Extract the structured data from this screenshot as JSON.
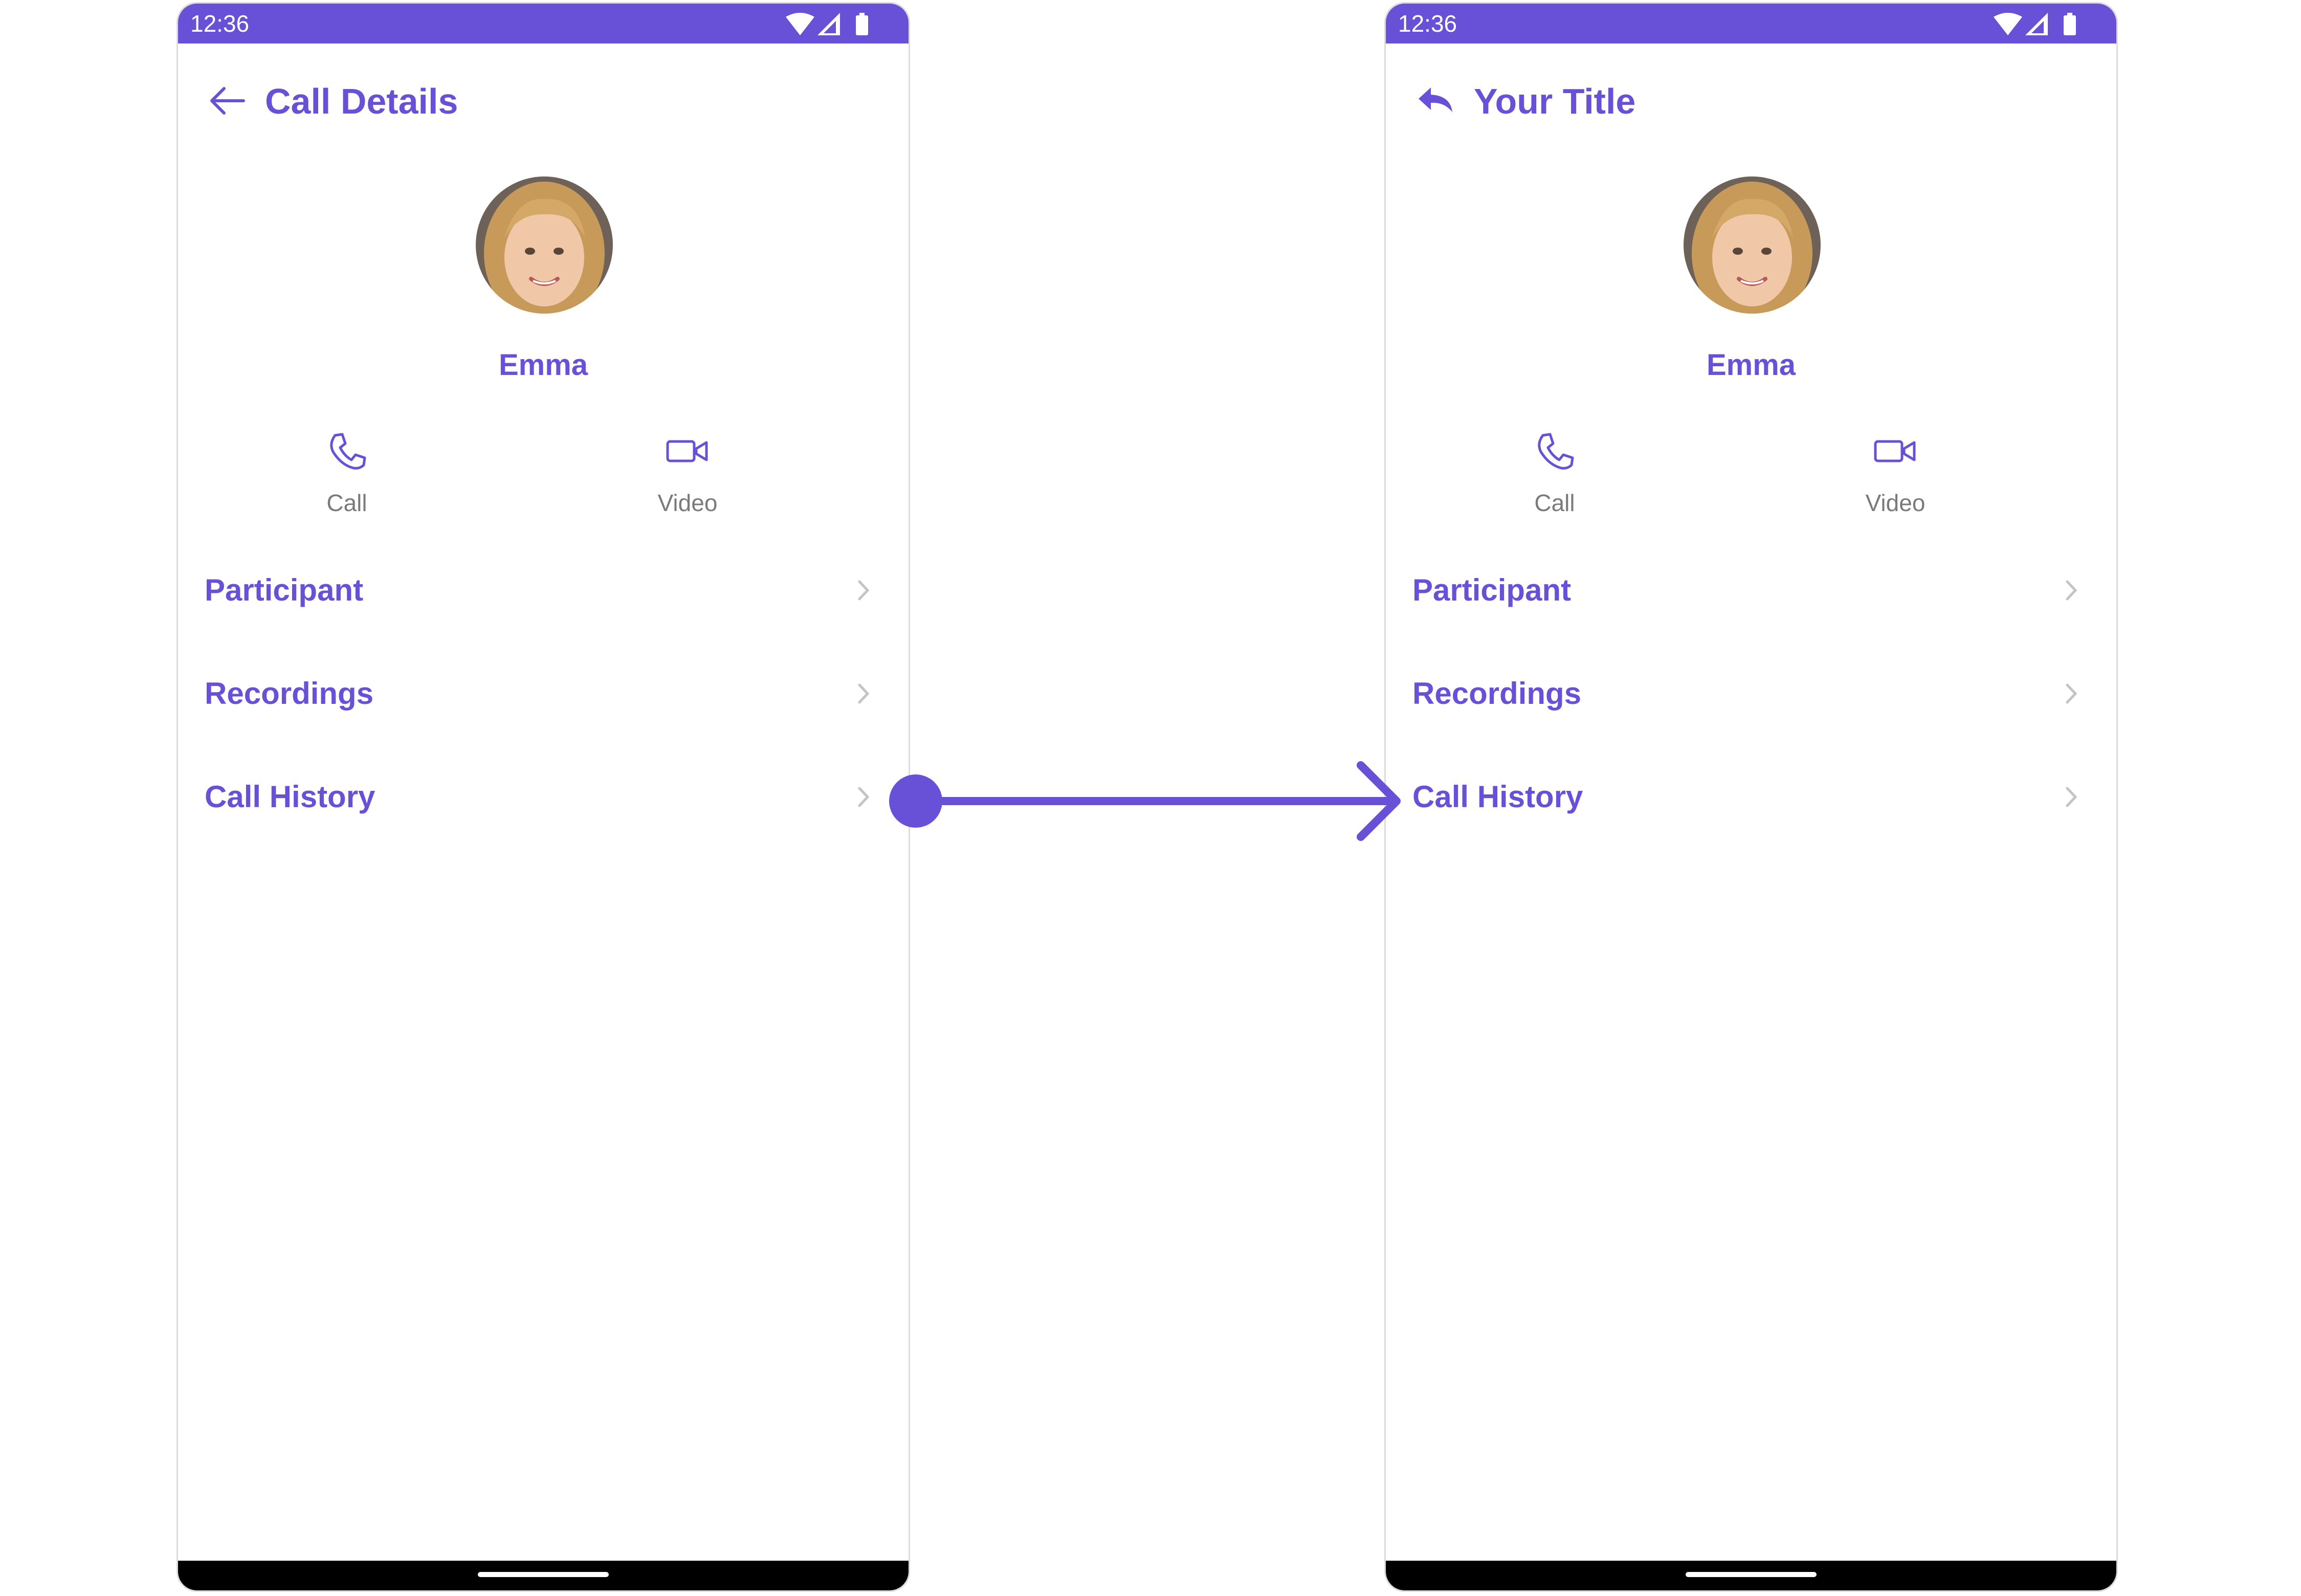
{
  "colors": {
    "accent": "#6851d6",
    "muted_label": "#7a7a7a",
    "chevron": "#c4c4c4",
    "nav_bar": "#000000"
  },
  "screens": [
    {
      "status_time": "12:36",
      "back_icon": "arrow-left-icon",
      "title": "Call Details",
      "user_name": "Emma",
      "actions": [
        {
          "label": "Call",
          "icon": "phone-icon"
        },
        {
          "label": "Video",
          "icon": "video-camera-icon"
        }
      ],
      "items": [
        {
          "label": "Participant"
        },
        {
          "label": "Recordings"
        },
        {
          "label": "Call History"
        }
      ]
    },
    {
      "status_time": "12:36",
      "back_icon": "reply-arrow-icon",
      "title": "Your Title",
      "user_name": "Emma",
      "actions": [
        {
          "label": "Call",
          "icon": "phone-icon"
        },
        {
          "label": "Video",
          "icon": "video-camera-icon"
        }
      ],
      "items": [
        {
          "label": "Participant"
        },
        {
          "label": "Recordings"
        },
        {
          "label": "Call History"
        }
      ]
    }
  ]
}
